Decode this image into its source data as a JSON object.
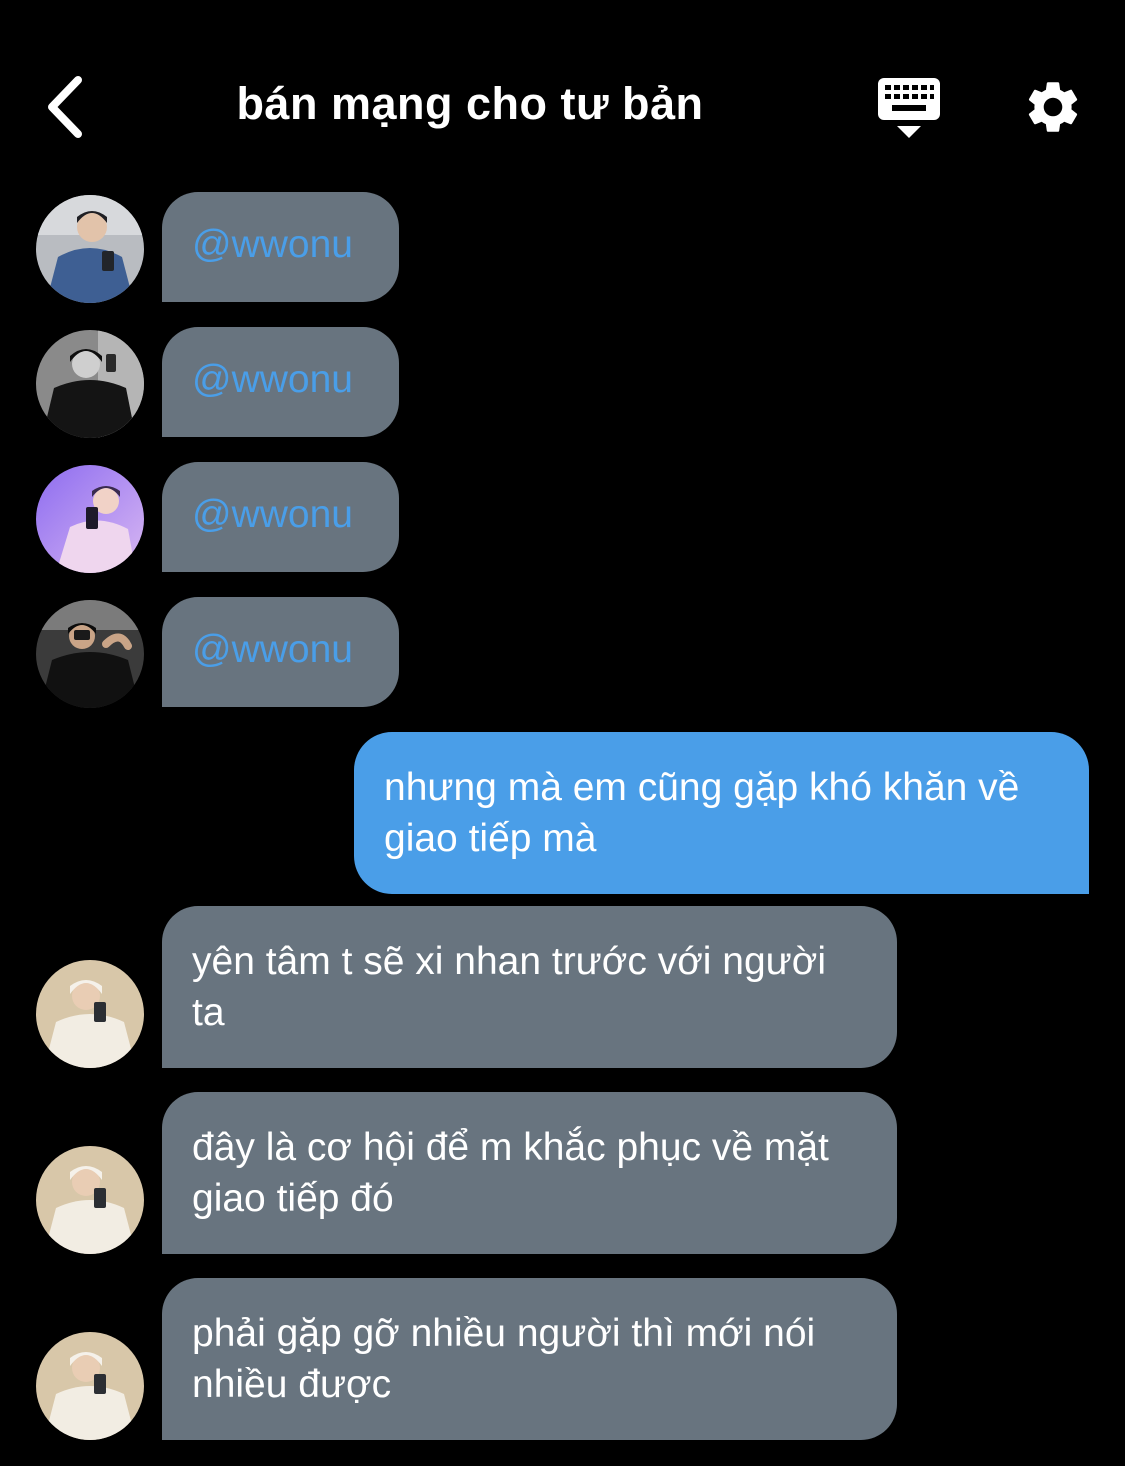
{
  "header": {
    "title": "bán mạng cho tư bản",
    "back_icon": "chevron-left-icon",
    "keyboard_icon": "keyboard-icon",
    "settings_icon": "gear-icon"
  },
  "colors": {
    "background": "#000000",
    "incoming_bubble": "#68747f",
    "outgoing_bubble": "#4a9ee8",
    "mention_text": "#4a9ee8"
  },
  "messages": [
    {
      "direction": "incoming",
      "text": "@wwonu"
    },
    {
      "direction": "incoming",
      "text": "@wwonu"
    },
    {
      "direction": "incoming",
      "text": "@wwonu"
    },
    {
      "direction": "incoming",
      "text": "@wwonu"
    },
    {
      "direction": "outgoing",
      "text": "nhưng mà em cũng gặp khó khăn về giao tiếp mà"
    },
    {
      "direction": "incoming",
      "text": "yên tâm t sẽ xi nhan trước với người ta"
    },
    {
      "direction": "incoming",
      "text": "đây là cơ hội để m khắc phục về mặt giao tiếp đó"
    },
    {
      "direction": "incoming",
      "text": "phải gặp gỡ nhiều người thì mới nói nhiều được"
    }
  ]
}
